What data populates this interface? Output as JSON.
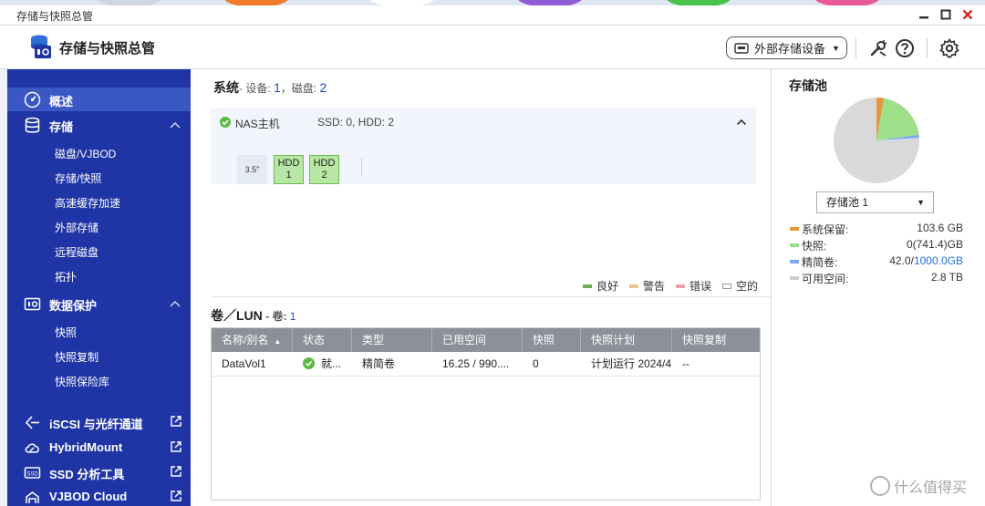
{
  "window": {
    "title": "存储与快照总管"
  },
  "header": {
    "app_title": "存储与快照总管",
    "external_storage_label": "外部存储设备"
  },
  "sidebar": {
    "sections": [
      {
        "label": "概述",
        "selected": true
      },
      {
        "label": "存储",
        "sub": [
          "磁盘/VJBOD",
          "存储/快照",
          "高速缓存加速",
          "外部存储",
          "远程磁盘",
          "拓扑"
        ]
      },
      {
        "label": "数据保护",
        "sub": [
          "快照",
          "快照复制",
          "快照保险库"
        ]
      }
    ],
    "external_links": [
      "iSCSI 与光纤通道",
      "HybridMount",
      "SSD 分析工具",
      "VJBOD Cloud"
    ]
  },
  "system": {
    "title": "系统",
    "devices_label": "- 设备: ",
    "devices_count": "1",
    "disks_label": "，磁盘: ",
    "disks_count": "2",
    "nas_name": "NAS主机",
    "nas_disks": "SSD: 0, HDD: 2",
    "bay_size": "3.5\"",
    "bays": [
      {
        "label": "HDD",
        "num": "1"
      },
      {
        "label": "HDD",
        "num": "2"
      }
    ]
  },
  "legend": [
    {
      "label": "良好",
      "color": "#6ab04c"
    },
    {
      "label": "警告",
      "color": "#e8c98a"
    },
    {
      "label": "错误",
      "color": "#e9a3a6"
    },
    {
      "label": "空的",
      "color": "#ffffff"
    }
  ],
  "lun": {
    "title": "卷／LUN",
    "count_label": " - 卷: ",
    "count": "1",
    "columns": [
      "名称/别名",
      "状态",
      "类型",
      "已用空间",
      "快照",
      "快照计划",
      "快照复制"
    ],
    "rows": [
      {
        "name": "DataVol1",
        "status": "就...",
        "type": "精简卷",
        "used": "16.25 / 990....",
        "snapshots": "0",
        "schedule": "计划运行 2024/4",
        "replication": "--"
      }
    ]
  },
  "pool": {
    "title": "存储池",
    "selected": "存储池 1",
    "stats": [
      {
        "key": "系统保留:",
        "value": "103.6 GB",
        "color": "#e8973a"
      },
      {
        "key": "快照:",
        "value": "0(741.4)GB",
        "color": "#9ee08a"
      },
      {
        "key": "精简卷:",
        "value": "42.0/",
        "value_blue": "1000.0GB",
        "color": "#7aaaf0"
      },
      {
        "key": "可用空间:",
        "value": "2.8 TB",
        "color": "#cfcfcf"
      }
    ],
    "pie": {
      "system_reserved": 103.6,
      "snapshots": 741.4,
      "thin_volume": 42.0,
      "free": 2800,
      "unit": "GB"
    }
  },
  "watermark": "什么值得买"
}
